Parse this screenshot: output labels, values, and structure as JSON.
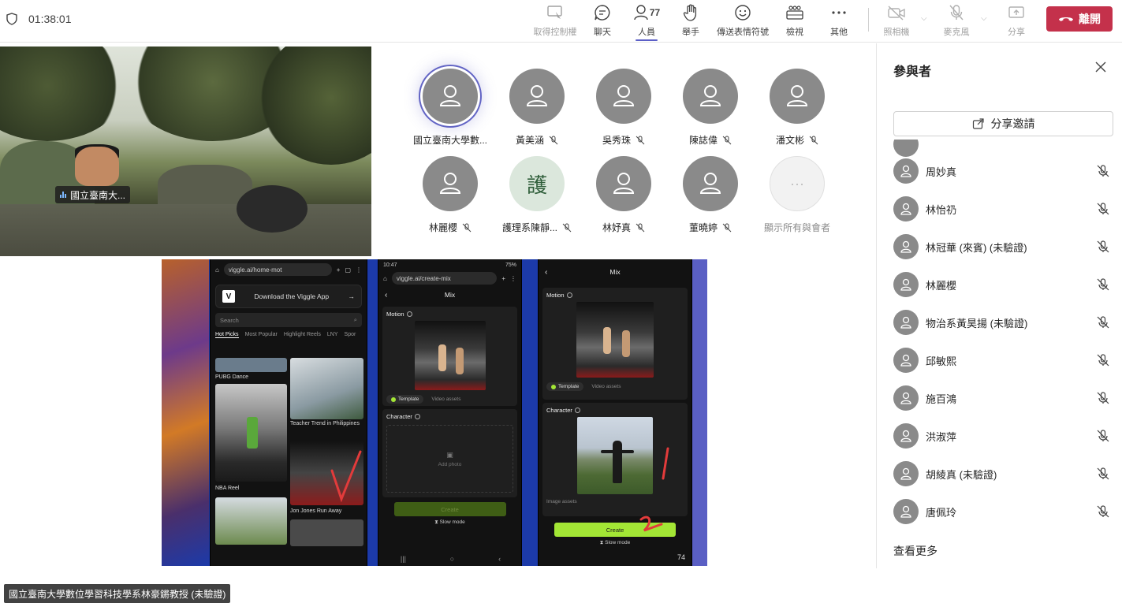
{
  "meeting": {
    "timer": "01:38:01"
  },
  "toolbar": {
    "items": [
      {
        "label": "取得控制權",
        "icon": "take-control-icon",
        "disabled": true
      },
      {
        "label": "聊天",
        "icon": "chat-icon"
      },
      {
        "label": "人員",
        "icon": "people-icon",
        "count": "77",
        "active": true
      },
      {
        "label": "舉手",
        "icon": "raise-hand-icon"
      },
      {
        "label": "傳送表情符號",
        "icon": "emoji-icon"
      },
      {
        "label": "檢視",
        "icon": "view-icon"
      },
      {
        "label": "其他",
        "icon": "more-icon"
      },
      {
        "label": "照相機",
        "icon": "camera-off-icon",
        "disabled": true
      },
      {
        "label": "麥克風",
        "icon": "mic-off-icon",
        "disabled": true
      },
      {
        "label": "分享",
        "icon": "share-icon",
        "disabled": true
      }
    ],
    "leave_label": "離開",
    "leave_color": "#c4314b",
    "accent_color": "#5b5fc7"
  },
  "camera": {
    "name_tag": "國立臺南大..."
  },
  "gallery": [
    {
      "name": "國立臺南大學數...",
      "highlight": true,
      "muted": false
    },
    {
      "name": "黃美涵",
      "muted": true
    },
    {
      "name": "吳秀珠",
      "muted": true
    },
    {
      "name": "陳誌偉",
      "muted": true
    },
    {
      "name": "潘文彬",
      "muted": true
    },
    {
      "name": "林麗櫻",
      "muted": true
    },
    {
      "name": "護理系陳靜...",
      "initial": "護",
      "muted": true
    },
    {
      "name": "林妤真",
      "muted": true
    },
    {
      "name": "董曉婷",
      "muted": true
    },
    {
      "name": "顯示所有與會者",
      "more": true
    }
  ],
  "shared_screen": {
    "sharer_label": "國立臺南大學數位學習科技學系林豪鏘教授 (未驗證)",
    "phone1": {
      "url": "viggle.ai/home-mot",
      "download_label": "Download the Viggle App",
      "search_placeholder": "Search",
      "categories": [
        "Hot Picks",
        "Most Popular",
        "Highlight Reels",
        "LNY",
        "Spor"
      ],
      "captions": [
        "PUBG Dance",
        "Teacher Trend in Philippines",
        "NBA Reel",
        "Jon Jones Run Away"
      ]
    },
    "phone2": {
      "status_time": "10:47",
      "battery": "75%",
      "url": "viggle.ai/create-mix",
      "title": "Mix",
      "motion_label": "Motion",
      "template_label": "Template",
      "video_assets_label": "Video assets",
      "character_label": "Character",
      "add_photo_label": "Add photo",
      "create_label": "Create",
      "slow_mode_label": "Slow mode"
    },
    "phone3": {
      "title": "Mix",
      "motion_label": "Motion",
      "template_label": "Template",
      "video_assets_label": "Video assets",
      "character_label": "Character",
      "image_assets_label": "Image assets",
      "create_label": "Create",
      "slow_mode_label": "Slow mode",
      "corner_number": "74"
    }
  },
  "panel": {
    "title": "參與者",
    "invite_label": "分享邀請",
    "participants": [
      {
        "name": "周妙真"
      },
      {
        "name": "林怡礽"
      },
      {
        "name": "林冠華 (來賓) (未驗證)"
      },
      {
        "name": "林麗櫻"
      },
      {
        "name": "物治系黃昊揚 (未驗證)"
      },
      {
        "name": "邱敏熙"
      },
      {
        "name": "施百鴻"
      },
      {
        "name": "洪淑萍"
      },
      {
        "name": "胡綾真 (未驗證)"
      },
      {
        "name": "唐佩玲"
      }
    ],
    "see_more_label": "查看更多"
  }
}
